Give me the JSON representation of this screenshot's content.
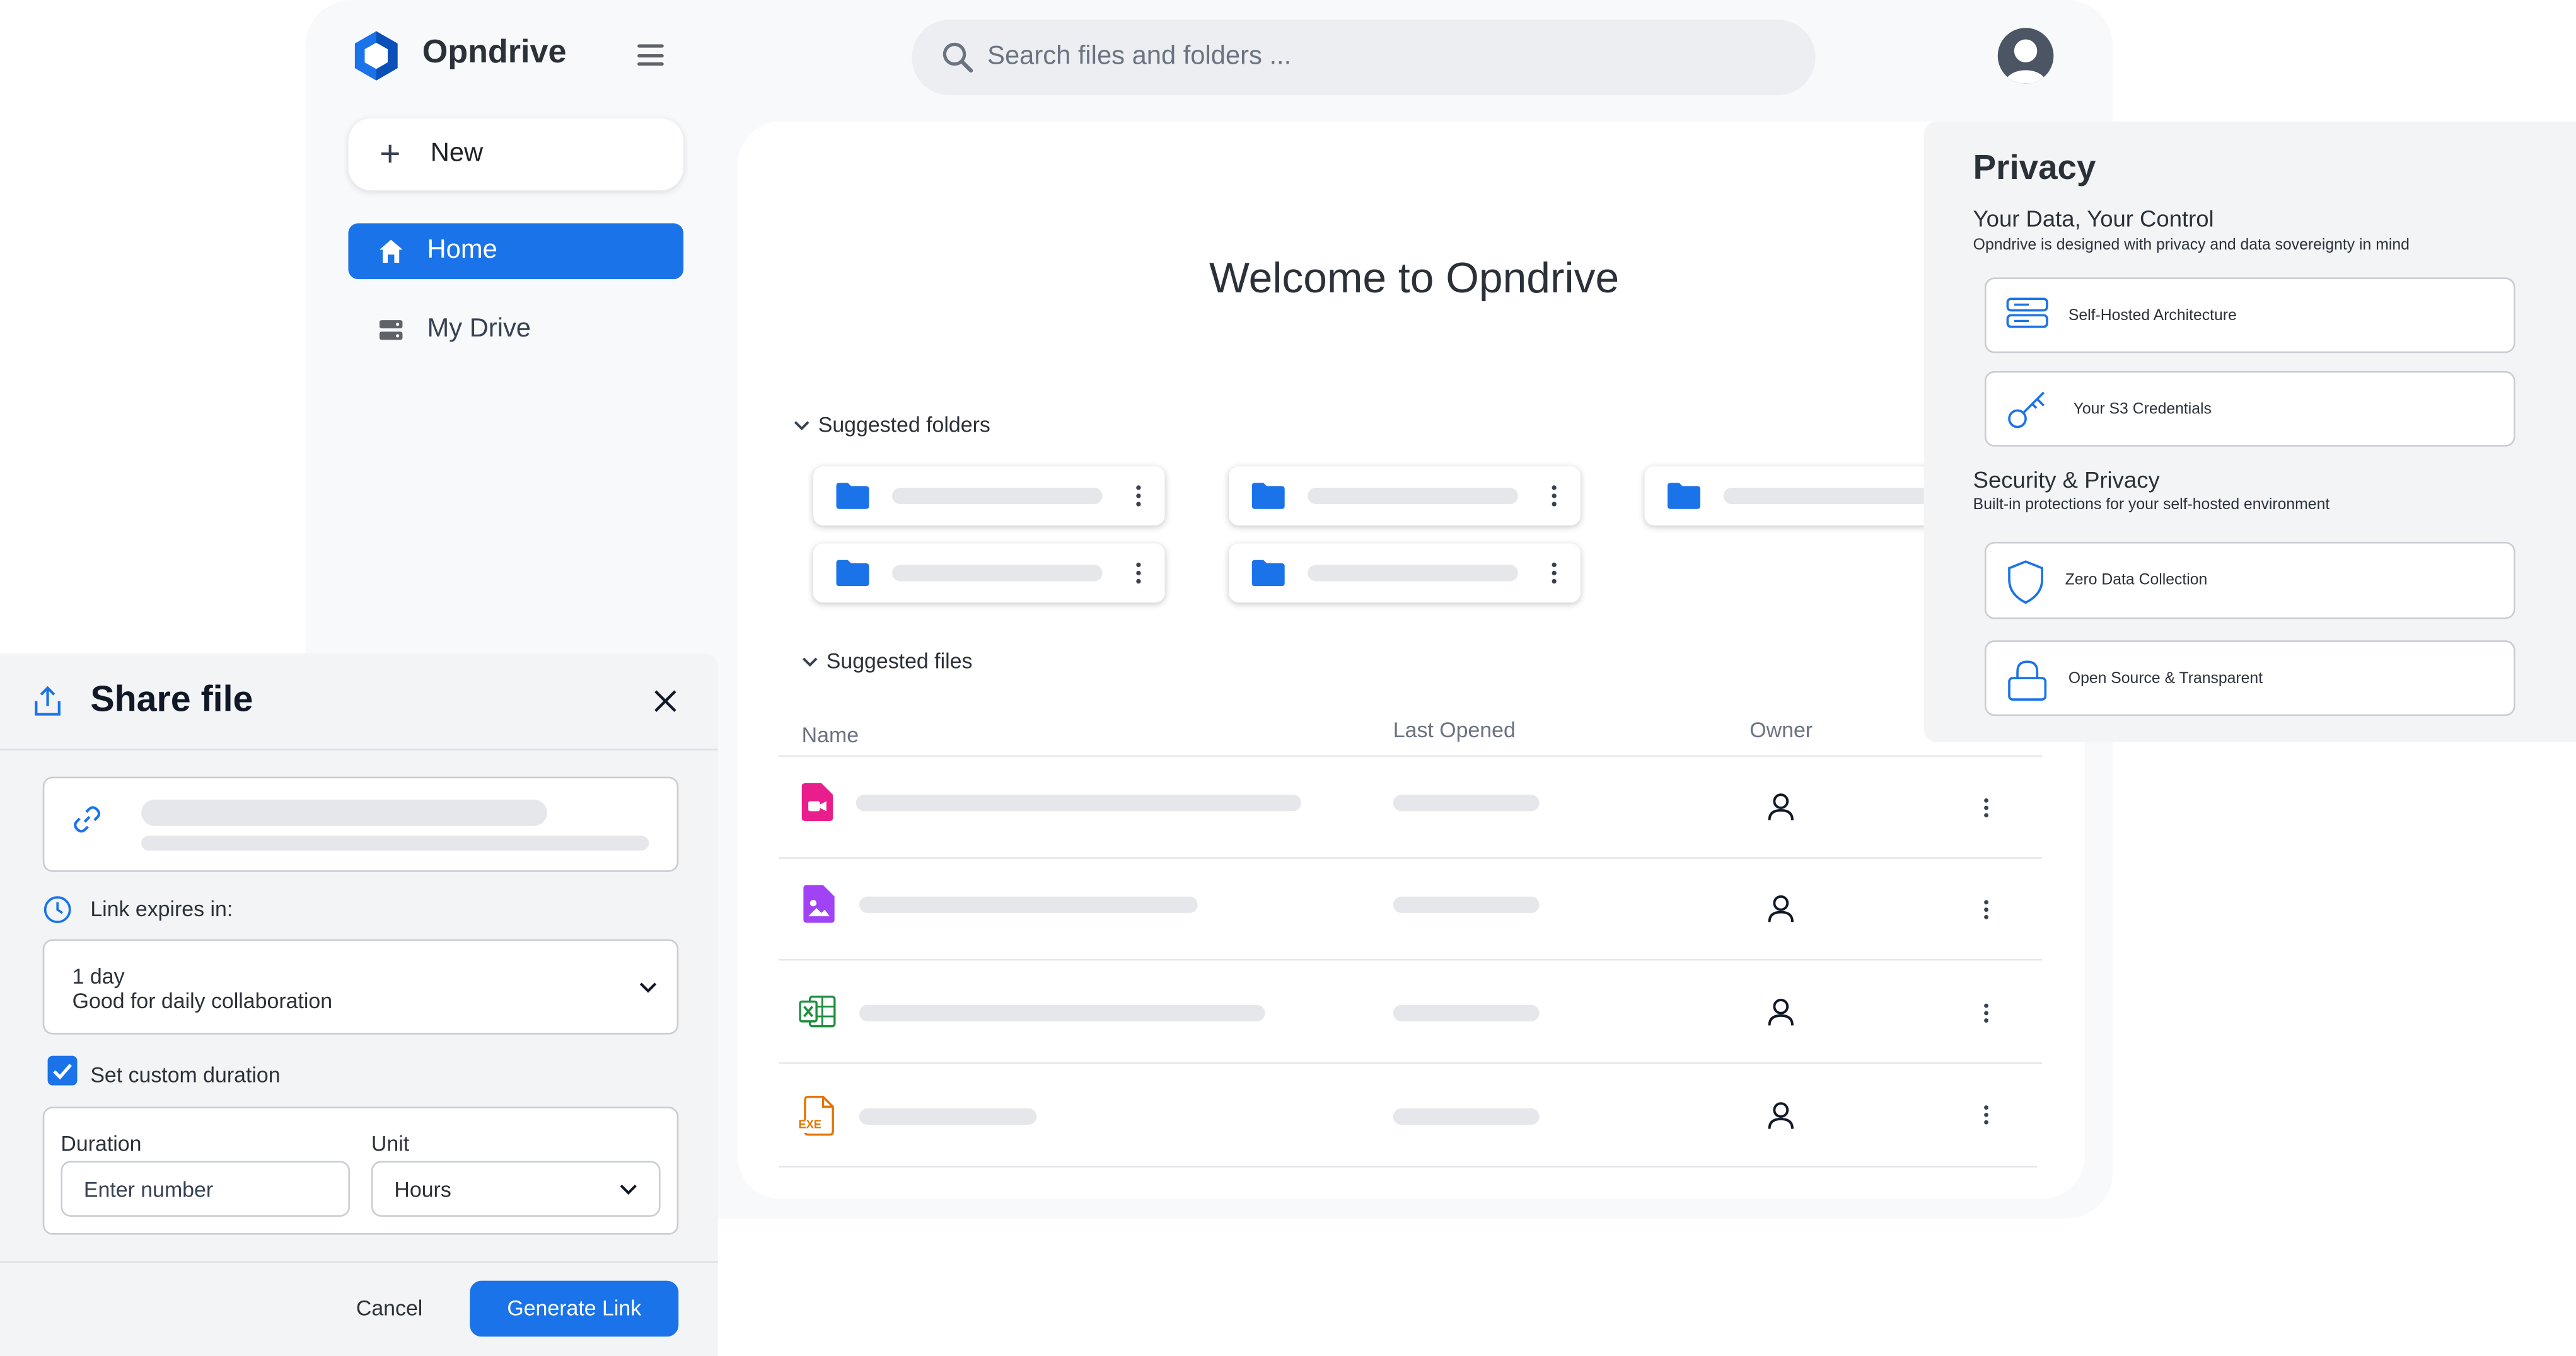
{
  "app": {
    "brand": "Opndrive",
    "search_placeholder": "Search files and folders ...",
    "accent_color": "#1a73e8"
  },
  "sidebar": {
    "new_label": "New",
    "items": [
      {
        "label": "Home",
        "icon": "home-icon",
        "active": true
      },
      {
        "label": "My Drive",
        "icon": "drive-icon",
        "active": false
      }
    ]
  },
  "main": {
    "welcome": "Welcome to Opndrive",
    "suggested_folders_label": "Suggested folders",
    "suggested_files_label": "Suggested files",
    "columns": {
      "name": "Name",
      "last_opened": "Last Opened",
      "owner": "Owner"
    },
    "files": [
      {
        "icon": "video-file-icon",
        "color": "#e91e8c"
      },
      {
        "icon": "image-file-icon",
        "color": "#a142f4"
      },
      {
        "icon": "spreadsheet-file-icon",
        "color": "#1e8e3e"
      },
      {
        "icon": "exe-file-icon",
        "color": "#e37400",
        "badge": "EXE"
      }
    ]
  },
  "privacy": {
    "title": "Privacy",
    "section1_title": "Your Data, Your Control",
    "section1_sub": "Opndrive is designed with privacy and data sovereignty in mind",
    "section1_items": [
      "Self-Hosted Architecture",
      "Your S3 Credentials"
    ],
    "section2_title": "Security & Privacy",
    "section2_sub": "Built-in protections for your self-hosted environment",
    "section2_items": [
      "Zero Data Collection",
      "Open Source & Transparent"
    ]
  },
  "share": {
    "title": "Share file",
    "expires_label": "Link expires in:",
    "expiry_value": "1 day",
    "expiry_desc": "Good for daily collaboration",
    "custom_label": "Set custom duration",
    "custom_checked": true,
    "duration_label": "Duration",
    "duration_placeholder": "Enter number",
    "unit_label": "Unit",
    "unit_value": "Hours",
    "cancel_label": "Cancel",
    "generate_label": "Generate Link"
  }
}
